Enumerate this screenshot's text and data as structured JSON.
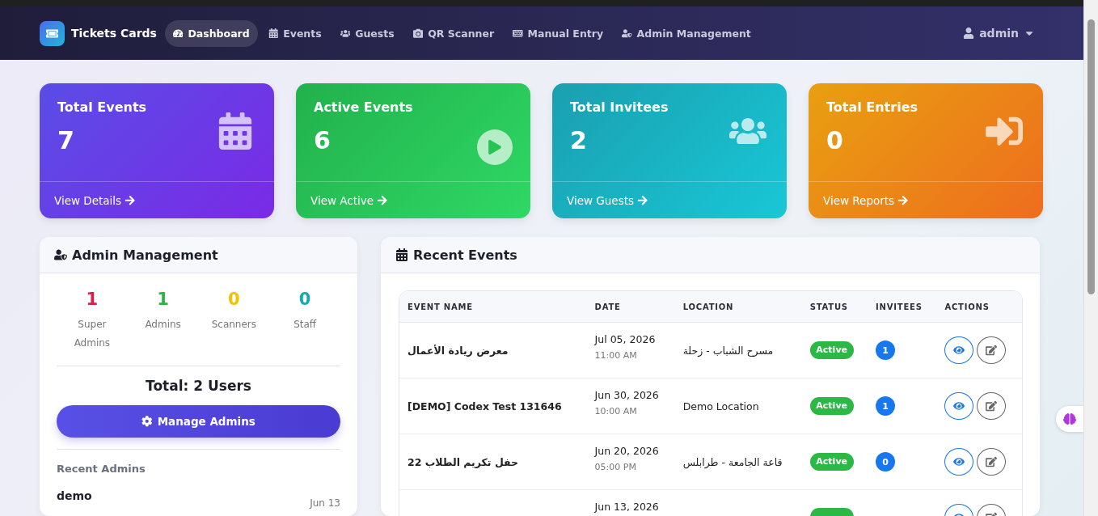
{
  "navbar": {
    "brand": "Tickets Cards",
    "items": [
      {
        "label": "Dashboard",
        "selected": true
      },
      {
        "label": "Events",
        "selected": false
      },
      {
        "label": "Guests",
        "selected": false
      },
      {
        "label": "QR Scanner",
        "selected": false
      },
      {
        "label": "Manual Entry",
        "selected": false
      },
      {
        "label": "Admin Management",
        "selected": false
      }
    ],
    "user": "admin"
  },
  "stat_cards": [
    {
      "kind": "purple",
      "title": "Total Events",
      "value": "7",
      "link": "View Details"
    },
    {
      "kind": "green",
      "title": "Active Events",
      "value": "6",
      "link": "View Active"
    },
    {
      "kind": "teal",
      "title": "Total Invitees",
      "value": "2",
      "link": "View Guests"
    },
    {
      "kind": "orange",
      "title": "Total Entries",
      "value": "0",
      "link": "View Reports"
    }
  ],
  "admin_panel": {
    "title": "Admin Management",
    "stats": [
      {
        "value": "1",
        "label": "Super Admins",
        "color": "#dc1f4a"
      },
      {
        "value": "1",
        "label": "Admins",
        "color": "#2fb344"
      },
      {
        "value": "0",
        "label": "Scanners",
        "color": "#f5c000"
      },
      {
        "value": "0",
        "label": "Staff",
        "color": "#17a9b5"
      }
    ],
    "total": "Total: 2 Users",
    "button": "Manage Admins",
    "recent_title": "Recent Admins",
    "recent": [
      {
        "name": "demo",
        "date": "Jun 13"
      }
    ]
  },
  "events_panel": {
    "title": "Recent Events",
    "columns": [
      "EVENT NAME",
      "DATE",
      "LOCATION",
      "STATUS",
      "INVITEES",
      "ACTIONS"
    ],
    "rows": [
      {
        "name": "معرض ريادة الأعمال",
        "date": "Jul 05, 2026",
        "time": "11:00 AM",
        "location": "مسرح الشباب - زحلة",
        "status": "Active",
        "active": true,
        "invitees": "1"
      },
      {
        "name": "[DEMO] Codex Test 131646",
        "date": "Jun 30, 2026",
        "time": "10:00 AM",
        "location": "Demo Location",
        "status": "Active",
        "active": true,
        "invitees": "1"
      },
      {
        "name": "حفل تكريم الطلاب 22",
        "date": "Jun 20, 2026",
        "time": "05:00 PM",
        "location": "قاعة الجامعة - طرابلس",
        "status": "Active",
        "active": true,
        "invitees": "0"
      },
      {
        "date": "Jun 13, 2026",
        "active": true
      }
    ]
  }
}
